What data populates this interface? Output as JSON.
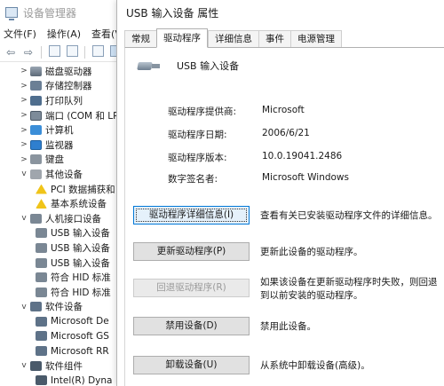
{
  "device_manager": {
    "title": "设备管理器",
    "menu": [
      "文件(F)",
      "操作(A)",
      "查看(V)"
    ],
    "toolbar_icons": [
      "back-icon",
      "forward-icon",
      "properties-icon",
      "help-icon",
      "refresh-icon",
      "monitor-icon"
    ],
    "tree": [
      {
        "label": "磁盘驱动器",
        "indent": 1,
        "chevron": ">",
        "icon": "drive"
      },
      {
        "label": "存储控制器",
        "indent": 1,
        "chevron": ">",
        "icon": "storage"
      },
      {
        "label": "打印队列",
        "indent": 1,
        "chevron": ">",
        "icon": "printq"
      },
      {
        "label": "端口 (COM 和 LP",
        "indent": 1,
        "chevron": ">",
        "icon": "port"
      },
      {
        "label": "计算机",
        "indent": 1,
        "chevron": ">",
        "icon": "computer"
      },
      {
        "label": "监视器",
        "indent": 1,
        "chevron": ">",
        "icon": "monitor"
      },
      {
        "label": "键盘",
        "indent": 1,
        "chevron": ">",
        "icon": "keyboard"
      },
      {
        "label": "其他设备",
        "indent": 1,
        "chevron": "v",
        "icon": "other"
      },
      {
        "label": "PCI 数据捕获和",
        "indent": 2,
        "chevron": "",
        "icon": "warn"
      },
      {
        "label": "基本系统设备",
        "indent": 2,
        "chevron": "",
        "icon": "warn"
      },
      {
        "label": "人机接口设备",
        "indent": 1,
        "chevron": "v",
        "icon": "hid"
      },
      {
        "label": "USB 输入设备",
        "indent": 2,
        "chevron": "",
        "icon": "hid"
      },
      {
        "label": "USB 输入设备",
        "indent": 2,
        "chevron": "",
        "icon": "hid"
      },
      {
        "label": "USB 输入设备",
        "indent": 2,
        "chevron": "",
        "icon": "hid"
      },
      {
        "label": "符合 HID 标准",
        "indent": 2,
        "chevron": "",
        "icon": "hid"
      },
      {
        "label": "符合 HID 标准",
        "indent": 2,
        "chevron": "",
        "icon": "hid"
      },
      {
        "label": "软件设备",
        "indent": 1,
        "chevron": "v",
        "icon": "soft"
      },
      {
        "label": "Microsoft De",
        "indent": 2,
        "chevron": "",
        "icon": "soft"
      },
      {
        "label": "Microsoft GS",
        "indent": 2,
        "chevron": "",
        "icon": "soft"
      },
      {
        "label": "Microsoft RR",
        "indent": 2,
        "chevron": "",
        "icon": "soft"
      },
      {
        "label": "软件组件",
        "indent": 1,
        "chevron": "v",
        "icon": "chip"
      },
      {
        "label": "Intel(R) Dyna",
        "indent": 2,
        "chevron": "",
        "icon": "chip"
      }
    ]
  },
  "dialog": {
    "title": "USB 输入设备 属性",
    "tabs": [
      "常规",
      "驱动程序",
      "详细信息",
      "事件",
      "电源管理"
    ],
    "active_tab": 1,
    "device_name": "USB 输入设备",
    "fields": [
      {
        "label": "驱动程序提供商:",
        "value": "Microsoft"
      },
      {
        "label": "驱动程序日期:",
        "value": "2006/6/21"
      },
      {
        "label": "驱动程序版本:",
        "value": "10.0.19041.2486"
      },
      {
        "label": "数字签名者:",
        "value": "Microsoft Windows"
      }
    ],
    "actions": [
      {
        "button": "驱动程序详细信息(I)",
        "desc": "查看有关已安装驱动程序文件的详细信息。",
        "state": "focused"
      },
      {
        "button": "更新驱动程序(P)",
        "desc": "更新此设备的驱动程序。",
        "state": "normal"
      },
      {
        "button": "回退驱动程序(R)",
        "desc": "如果该设备在更新驱动程序时失败，则回退到以前安装的驱动程序。",
        "state": "disabled"
      },
      {
        "button": "禁用设备(D)",
        "desc": "禁用此设备。",
        "state": "normal"
      },
      {
        "button": "卸载设备(U)",
        "desc": "从系统中卸载设备(高级)。",
        "state": "normal"
      }
    ]
  }
}
